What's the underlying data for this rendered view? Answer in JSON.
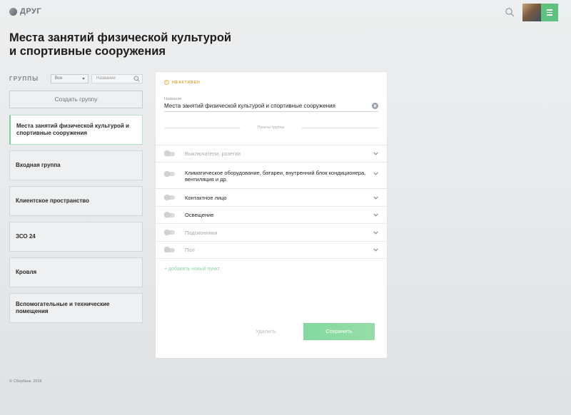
{
  "header": {
    "logo_text": "ДРУГ",
    "icons": {
      "search": "search-icon",
      "menu": "menu-icon",
      "avatar": "avatar"
    },
    "accent": "#5fc27e"
  },
  "page": {
    "title_line1": "Места занятий физической культурой",
    "title_line2": "и спортивные сооружения"
  },
  "sidebar": {
    "groups_label": "ГРУППЫ",
    "filter_value": "Все",
    "search_placeholder": "Название",
    "create_button": "Создать группу",
    "items": [
      {
        "label": "Места занятий физической культурой и спортивные сооружения",
        "active": true
      },
      {
        "label": "Входная группа",
        "active": false
      },
      {
        "label": "Клиентское пространство",
        "active": false
      },
      {
        "label": "ЗСО 24",
        "active": false
      },
      {
        "label": "Кровля",
        "active": false
      },
      {
        "label": "Вспомогательные и технические помещения",
        "active": false
      }
    ]
  },
  "detail": {
    "status": "НЕАКТИВЕН",
    "status_color": "#e6b74a",
    "name_label": "Название",
    "name_value": "Места занятий физической культурой и спортивные сооружения",
    "section_label": "Пункты группы",
    "items": [
      {
        "label": "Выключатели, розетки",
        "muted": true
      },
      {
        "label": "Климатическое оборудование, батареи, внутренний блок кондиционера, вентиляция и др.",
        "muted": false
      },
      {
        "label": "Контактное лицо",
        "muted": false
      },
      {
        "label": "Освещение",
        "muted": false
      },
      {
        "label": "Подоконники",
        "muted": true
      },
      {
        "label": "Пол",
        "muted": true
      }
    ],
    "add_item": "+ добавить новый пункт",
    "delete_button": "Удалить",
    "save_button": "Сохранить"
  },
  "footer": {
    "copyright": "© Сбербанк, 2016"
  }
}
